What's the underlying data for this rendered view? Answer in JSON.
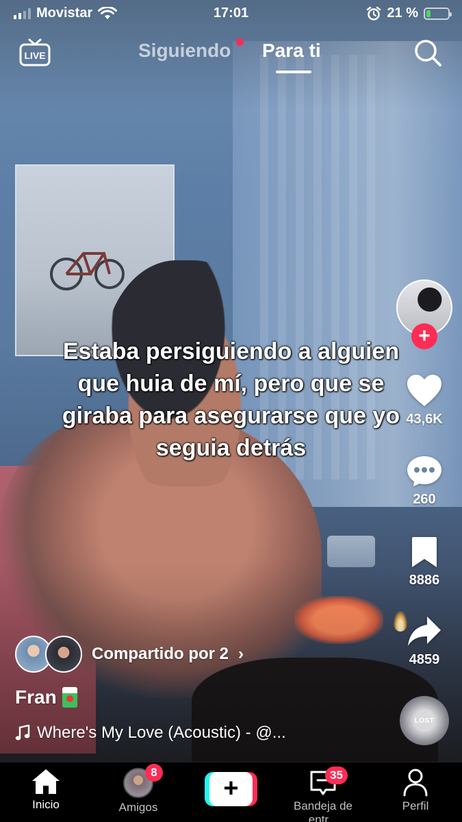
{
  "status_bar": {
    "carrier": "Movistar",
    "time": "17:01",
    "battery": "21 %",
    "battery_level": 0.21,
    "icons": [
      "signal-icon",
      "wifi-icon",
      "alarm-icon",
      "battery-charging-icon"
    ]
  },
  "top_nav": {
    "live_label": "LIVE",
    "tabs": [
      {
        "label": "Siguiendo",
        "has_dot": true,
        "active": false
      },
      {
        "label": "Para ti",
        "active": true
      }
    ],
    "search_icon": "search-icon"
  },
  "video": {
    "caption": "Estaba persiguiendo a alguien que huia de mí, pero que se giraba para asegurarse que yo seguia detrás"
  },
  "right_rail": {
    "likes": "43,6K",
    "comments": "260",
    "saves": "8886",
    "shares": "4859",
    "follow_icon": "plus-icon",
    "disc_label": "LOST"
  },
  "info": {
    "shared_by": "Compartido por 2",
    "author": "Fran",
    "music": "Where's My Love (Acoustic) - @..."
  },
  "tab_bar": {
    "items": [
      {
        "label": "Inicio",
        "icon": "home-icon",
        "active": true
      },
      {
        "label": "Amigos",
        "icon": "friends-avatar",
        "badge": "8"
      },
      {
        "label": "",
        "icon": "create-plus-icon"
      },
      {
        "label": "Bandeja de entr...",
        "icon": "inbox-icon",
        "badge": "35"
      },
      {
        "label": "Perfil",
        "icon": "profile-icon"
      }
    ]
  },
  "colors": {
    "accent_red": "#fe2c55",
    "accent_cyan": "#25f4ee",
    "battery_green": "#4cd964"
  }
}
